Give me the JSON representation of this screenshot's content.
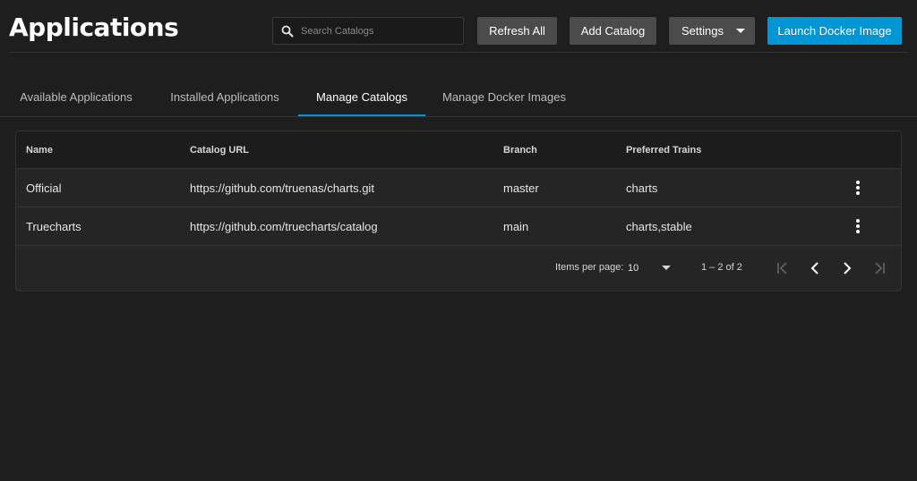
{
  "header": {
    "title": "Applications",
    "search": {
      "placeholder": "Search Catalogs",
      "value": ""
    },
    "buttons": {
      "refresh_all": "Refresh All",
      "add_catalog": "Add Catalog",
      "settings": "Settings",
      "launch_docker": "Launch Docker Image"
    }
  },
  "tabs": [
    {
      "label": "Available Applications",
      "active": false
    },
    {
      "label": "Installed Applications",
      "active": false
    },
    {
      "label": "Manage Catalogs",
      "active": true
    },
    {
      "label": "Manage Docker Images",
      "active": false
    }
  ],
  "table": {
    "columns": [
      "Name",
      "Catalog URL",
      "Branch",
      "Preferred Trains"
    ],
    "rows": [
      {
        "name": "Official",
        "url": "https://github.com/truenas/charts.git",
        "branch": "master",
        "trains": "charts"
      },
      {
        "name": "Truecharts",
        "url": "https://github.com/truecharts/catalog",
        "branch": "main",
        "trains": "charts,stable"
      }
    ]
  },
  "paginator": {
    "items_per_page_label": "Items per page:",
    "items_per_page": "10",
    "range": "1 – 2 of 2"
  },
  "colors": {
    "background": "#1e1e1e",
    "card": "#252525",
    "button": "#4b4b4b",
    "accent": "#0095d5"
  },
  "icons": {
    "search": "search-icon",
    "settings_caret": "caret-down-icon",
    "row_menu": "more-vert-icon",
    "first_page": "first-page-icon",
    "prev_page": "chevron-left-icon",
    "next_page": "chevron-right-icon",
    "last_page": "last-page-icon"
  }
}
